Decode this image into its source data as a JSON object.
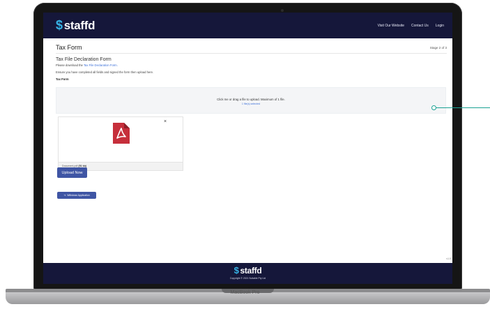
{
  "device": {
    "model_label": "MacBook Pro"
  },
  "header": {
    "brand": "staffd",
    "nav": [
      "Visit Our Website",
      "Contact Us",
      "Login"
    ]
  },
  "page": {
    "title": "Tax Form",
    "stage": "Stage 2 of 3"
  },
  "form": {
    "title": "Tax File Declaration Form",
    "download_prefix": "Please download the ",
    "download_link": "Tax File Declaration Form.",
    "instruction": "Ensure you have completed all fields and signed the form then upload here.",
    "field_label": "Tax Form"
  },
  "dropzone": {
    "text": "Click me or drag a file to upload. Maximum of 1 file.",
    "sub": "1 file(s) selected"
  },
  "file": {
    "name": "Document.pdf",
    "size": "(51 kb)",
    "close": "×",
    "type_icon": "pdf-file-icon",
    "icon_color": "#c62f3b"
  },
  "buttons": {
    "upload": "Upload Now",
    "withdraw": "Withdraw Application"
  },
  "version": "v1.0",
  "footer": {
    "brand": "staffd",
    "copyright": "Copyright © 2021 Suitable Pty Ltd"
  },
  "colors": {
    "header_bg": "#15173a",
    "accent": "#3f55a4",
    "link": "#3b6fd8",
    "callout": "#1ba293"
  }
}
